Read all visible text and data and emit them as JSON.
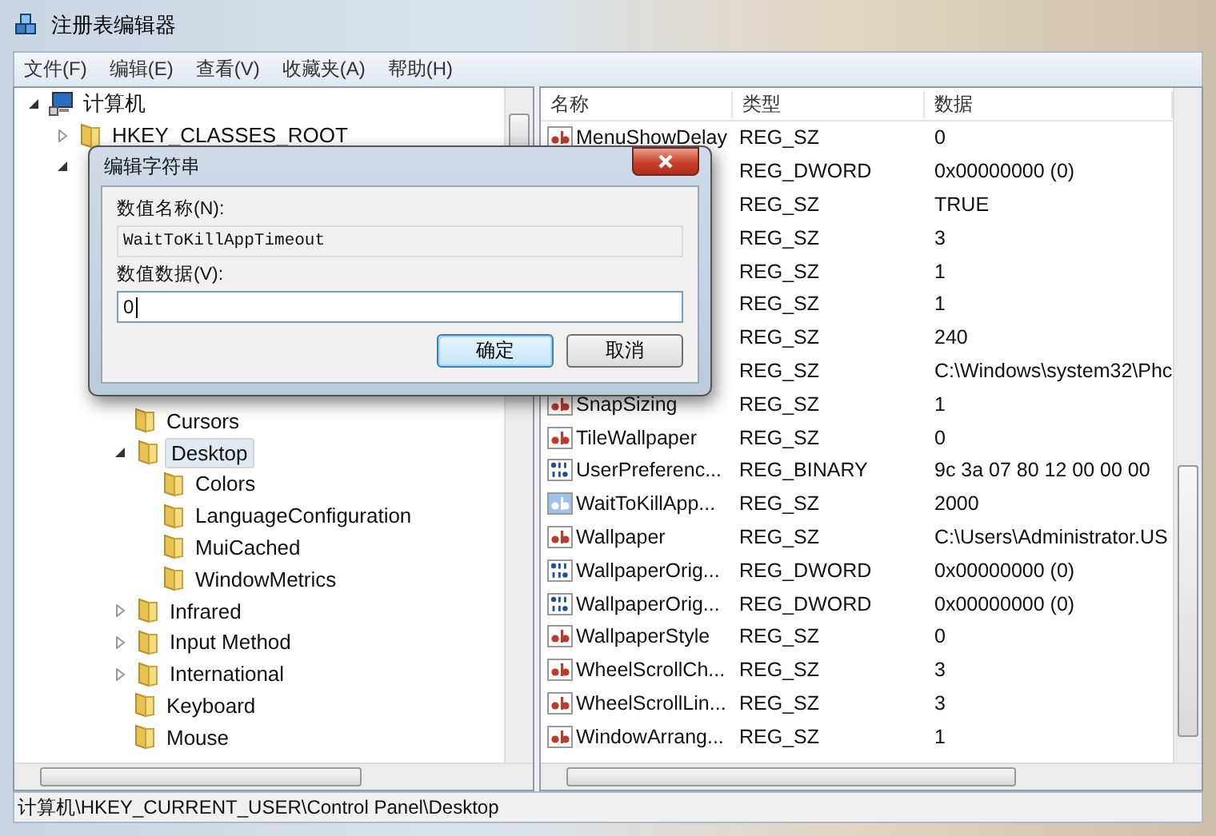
{
  "window": {
    "title": "注册表编辑器"
  },
  "menu": [
    "文件(F)",
    "编辑(E)",
    "查看(V)",
    "收藏夹(A)",
    "帮助(H)"
  ],
  "tree": [
    {
      "label": "计算机",
      "kind": "computer",
      "expanded": true,
      "selected": false,
      "children": [
        {
          "label": "HKEY_CLASSES_ROOT",
          "expanded": false,
          "selected": false
        },
        {
          "expanded": true,
          "children": [
            {
              "children": [
                {
                  "label": "Cursors",
                  "selected": false
                },
                {
                  "label": "Desktop",
                  "expanded": true,
                  "selected": true,
                  "children": [
                    {
                      "label": "Colors",
                      "selected": false
                    },
                    {
                      "label": "LanguageConfiguration",
                      "selected": false
                    },
                    {
                      "label": "MuiCached",
                      "selected": false
                    },
                    {
                      "label": "WindowMetrics",
                      "selected": false
                    }
                  ]
                },
                {
                  "label": "Infrared",
                  "expanded": false,
                  "selected": false
                },
                {
                  "label": "Input Method",
                  "expanded": false,
                  "selected": false
                },
                {
                  "label": "International",
                  "expanded": false,
                  "selected": false
                },
                {
                  "label": "Keyboard",
                  "selected": false
                },
                {
                  "label": "Mouse",
                  "selected": false
                }
              ]
            }
          ]
        }
      ]
    }
  ],
  "table": {
    "columns": [
      "名称",
      "类型",
      "数据"
    ],
    "rows": [
      {
        "name": "MenuShowDelay",
        "kind": "string",
        "type": "REG_SZ",
        "data": "0",
        "selected": false
      },
      {
        "type": "REG_DWORD",
        "data": "0x00000000 (0)"
      },
      {
        "type": "REG_SZ",
        "data": "TRUE"
      },
      {
        "type": "REG_SZ",
        "data": "3"
      },
      {
        "type": "REG_SZ",
        "data": "1"
      },
      {
        "type": "REG_SZ",
        "data": "1"
      },
      {
        "type": "REG_SZ",
        "data": "240"
      },
      {
        "type": "REG_SZ",
        "data": "C:\\Windows\\system32\\Phc"
      },
      {
        "name": "SnapSizing",
        "kind": "string",
        "type": "REG_SZ",
        "data": "1",
        "selected": false
      },
      {
        "name": "TileWallpaper",
        "kind": "string",
        "type": "REG_SZ",
        "data": "0",
        "selected": false
      },
      {
        "name": "UserPreferenc...",
        "kind": "binary",
        "type": "REG_BINARY",
        "data": "9c 3a 07 80 12 00 00 00",
        "selected": false
      },
      {
        "name": "WaitToKillApp...",
        "kind": "string",
        "type": "REG_SZ",
        "data": "2000",
        "selected": true
      },
      {
        "name": "Wallpaper",
        "kind": "string",
        "type": "REG_SZ",
        "data": "C:\\Users\\Administrator.US",
        "selected": false
      },
      {
        "name": "WallpaperOrig...",
        "kind": "binary",
        "type": "REG_DWORD",
        "data": "0x00000000 (0)",
        "selected": false
      },
      {
        "name": "WallpaperOrig...",
        "kind": "binary",
        "type": "REG_DWORD",
        "data": "0x00000000 (0)",
        "selected": false
      },
      {
        "name": "WallpaperStyle",
        "kind": "string",
        "type": "REG_SZ",
        "data": "0",
        "selected": false
      },
      {
        "name": "WheelScrollCh...",
        "kind": "string",
        "type": "REG_SZ",
        "data": "3",
        "selected": false
      },
      {
        "name": "WheelScrollLin...",
        "kind": "string",
        "type": "REG_SZ",
        "data": "3",
        "selected": false
      },
      {
        "name": "WindowArrang...",
        "kind": "string",
        "type": "REG_SZ",
        "data": "1",
        "selected": false
      }
    ]
  },
  "status_bar": "计算机\\HKEY_CURRENT_USER\\Control Panel\\Desktop",
  "dialog": {
    "title": "编辑字符串",
    "name_label": "数值名称(N):",
    "name_value": "WaitToKillAppTimeout",
    "data_label": "数值数据(V):",
    "data_value": "0",
    "buttons": [
      {
        "label": "确定",
        "default": true
      },
      {
        "label": "取消",
        "default": false
      }
    ]
  }
}
